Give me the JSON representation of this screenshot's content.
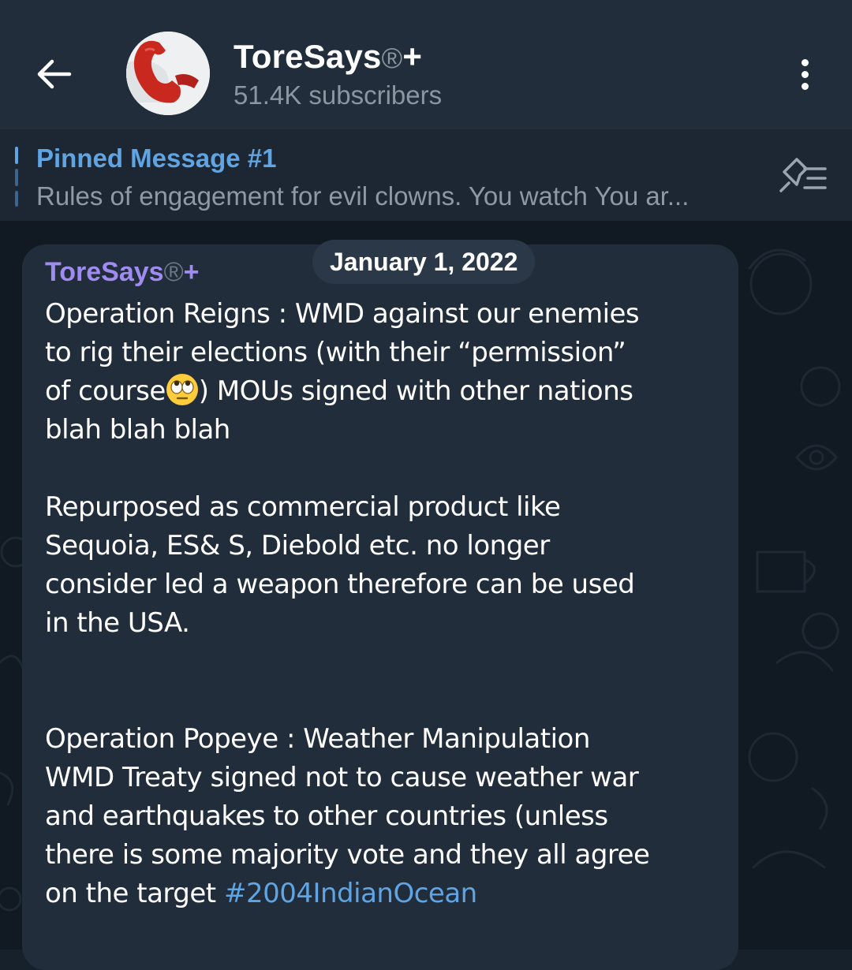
{
  "header": {
    "channel_name": "ToreSays",
    "registered_mark": "®",
    "plus_mark": "+",
    "subscribers": "51.4K subscribers"
  },
  "pinned": {
    "title": "Pinned Message #1",
    "text": "Rules of engagement for evil clowns.  You watch  You ar..."
  },
  "date_chip": "January 1, 2022",
  "message": {
    "sender": "ToreSays",
    "sender_mark": "®",
    "sender_plus": "+",
    "lines_1": [
      "Operation Reigns : WMD against our enemies",
      "to rig their elections (with their “permission”"
    ],
    "line_3_before_emoji": "of course",
    "line_3_after_emoji": ") MOUs signed with other nations",
    "line_4": "blah blah blah",
    "para_2": [
      "Repurposed as commercial product like",
      "Sequoia, ES& S, Diebold etc. no longer",
      "consider led a weapon therefore can be used",
      "in the USA."
    ],
    "para_3": [
      "Operation Popeye : Weather Manipulation",
      "WMD Treaty signed not to cause weather war",
      "and earthquakes to other countries (unless",
      "there is some majority vote and they all agree"
    ],
    "last_line_before_tag": "on the target ",
    "hashtag": "#2004IndianOcean",
    "emoji_name": "face-with-rolling-eyes"
  },
  "colors": {
    "header_bg": "#212d3b",
    "chat_bg": "#111a23",
    "bubble_bg": "#212d3b",
    "accent_blue": "#5fa4e3",
    "sender_purple": "#a08cf0"
  }
}
